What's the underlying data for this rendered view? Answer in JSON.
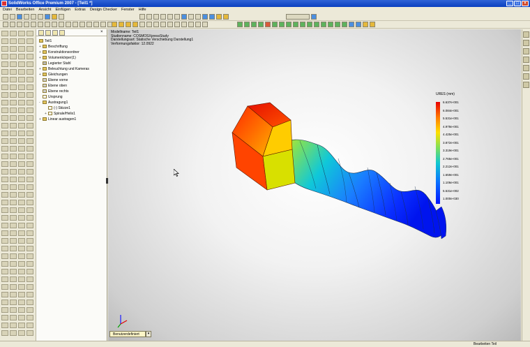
{
  "window": {
    "title": "SolidWorks Office Premium 2007 - [Teil1 *]",
    "buttons": [
      "_",
      "□",
      "×"
    ]
  },
  "menu": [
    "Datei",
    "Bearbeiten",
    "Ansicht",
    "Einfügen",
    "Extras",
    "Design Checker",
    "Fenster",
    "Hilfe"
  ],
  "feature_tree": {
    "root": "Teil1",
    "items": [
      {
        "label": "Beschriftung",
        "expand": "+"
      },
      {
        "label": "Konstruktionsordner",
        "expand": "+"
      },
      {
        "label": "Volumenkörper(1)",
        "expand": "+"
      },
      {
        "label": "Legierter Stahl",
        "expand": ""
      },
      {
        "label": "Beleuchtung und Kameras",
        "expand": "+"
      },
      {
        "label": "Gleichungen",
        "expand": "+"
      },
      {
        "label": "Ebene vorne",
        "expand": ""
      },
      {
        "label": "Ebene oben",
        "expand": ""
      },
      {
        "label": "Ebene rechts",
        "expand": ""
      },
      {
        "label": "Ursprung",
        "expand": ""
      },
      {
        "label": "Austragung1",
        "expand": "-"
      },
      {
        "label": "(-) Skizze1",
        "expand": ""
      },
      {
        "label": "Spirale/Helix1",
        "expand": "+"
      },
      {
        "label": "Linear austragen1",
        "expand": "+"
      }
    ]
  },
  "viewport": {
    "info": [
      "Modellname: Teil1",
      "Studienname: COSMOSXpressStudy",
      "Darstellungsart: Statische Verschiebung Darstellung1",
      "Verformungsfaktor: 12.0922"
    ],
    "legend_title": "URES (mm)",
    "legend_values": [
      "6.637e-001",
      "6.084e-001",
      "5.531e-001",
      "4.978e-001",
      "4.425e-001",
      "3.872e-001",
      "3.319e-001",
      "2.765e-001",
      "2.212e-001",
      "1.659e-001",
      "1.106e-001",
      "5.531e-002",
      "1.000e-030"
    ],
    "tab_label": "Benutzerdefiniert"
  },
  "status": {
    "text": "Bearbeiten Teil"
  }
}
